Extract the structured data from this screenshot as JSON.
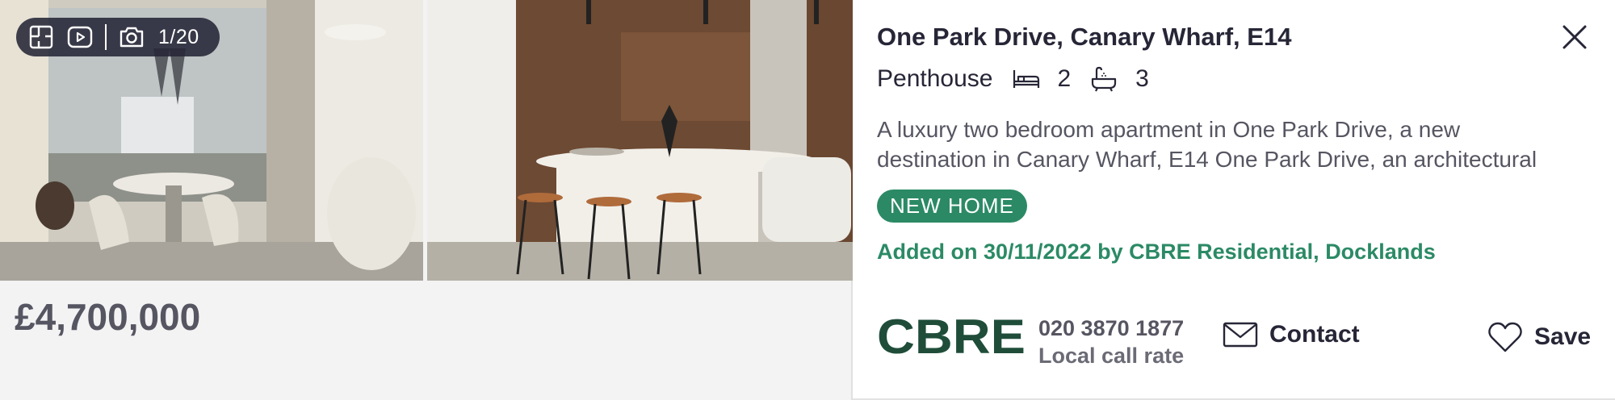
{
  "listing": {
    "photo_counter": "1/20",
    "price": "£4,700,000",
    "title": "One Park Drive, Canary Wharf, E14",
    "property_type": "Penthouse",
    "bedrooms": "2",
    "bathrooms": "3",
    "description": "A luxury two bedroom apartment in One Park Drive, a new destination in Canary Wharf, E14 One Park Drive, an architectural",
    "badge": "NEW HOME",
    "added_text": "Added on 30/11/2022 by CBRE Residential, Docklands"
  },
  "agent": {
    "logo_text": "CBRE",
    "phone": "020 3870 1877",
    "phone_note": "Local call rate",
    "contact_label": "Contact",
    "save_label": "Save"
  },
  "colors": {
    "accent_green": "#2b8a65",
    "cbre_green": "#1f4d3a",
    "text_dark": "#262637",
    "text_muted": "#565662"
  },
  "icons": {
    "toolbar": [
      "floorplan-icon",
      "video-icon",
      "camera-icon"
    ],
    "meta": [
      "bed-icon",
      "bath-icon"
    ],
    "actions": [
      "close-icon",
      "envelope-icon",
      "heart-icon"
    ]
  }
}
